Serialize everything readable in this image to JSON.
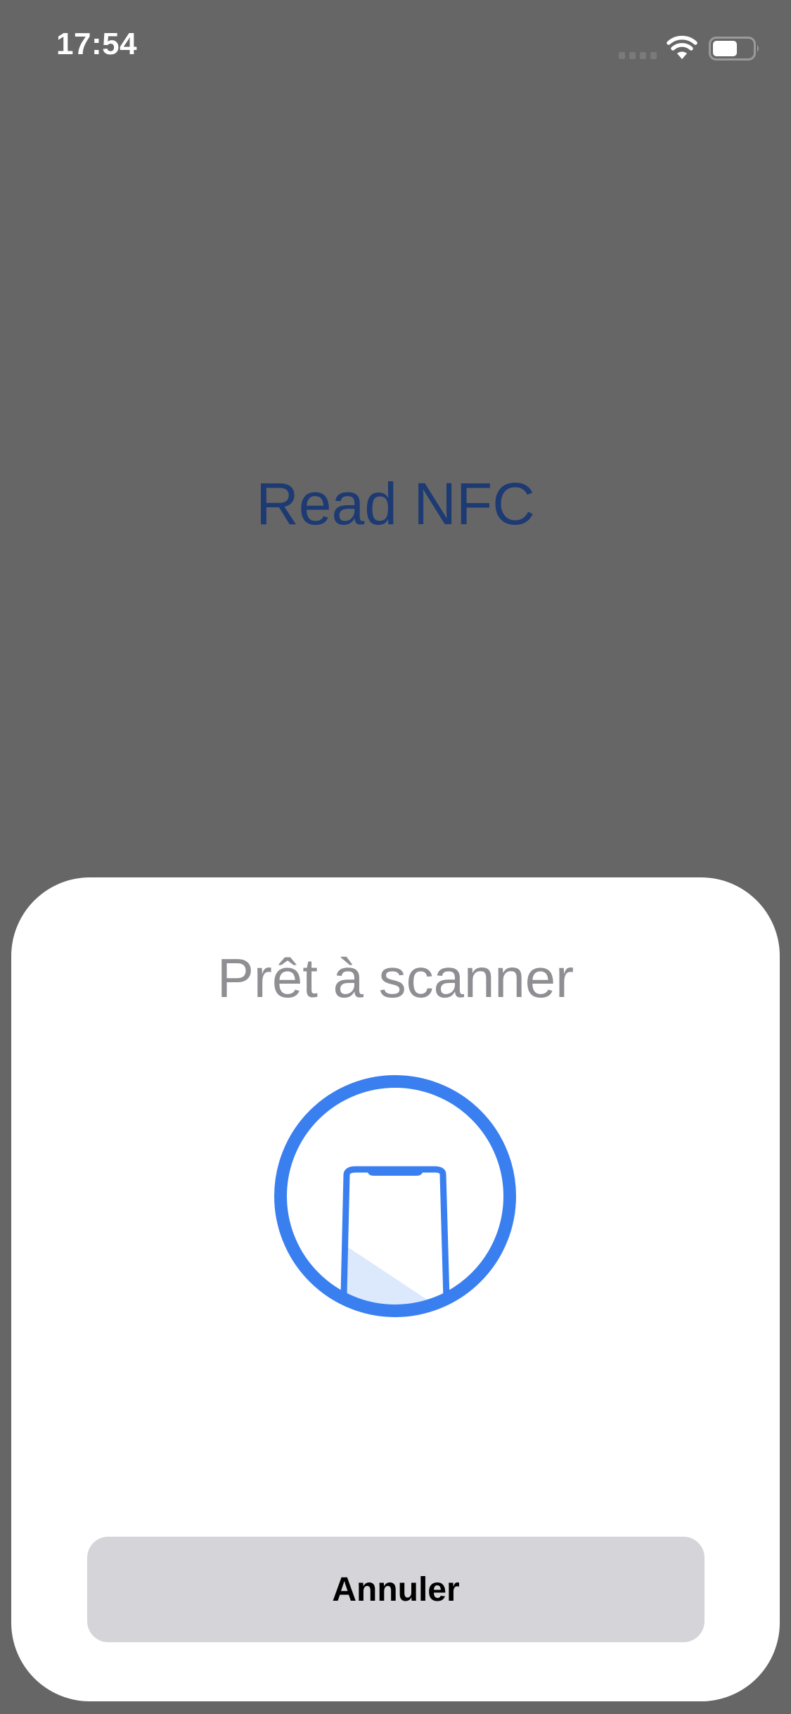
{
  "status_bar": {
    "time": "17:54",
    "icons": {
      "signal": "cellular-signal-icon",
      "wifi": "wifi-icon",
      "battery": "battery-icon"
    }
  },
  "main": {
    "title": "Read NFC"
  },
  "scan_sheet": {
    "title": "Prêt à scanner",
    "illustration": "phone-scan-icon",
    "cancel_label": "Annuler"
  },
  "colors": {
    "overlay_background": "#666666",
    "title_text": "#1d3a73",
    "accent_blue": "#3a7ff0",
    "sheet_background": "#ffffff",
    "sheet_title_text": "#8e8e93",
    "button_background": "#d4d4d9"
  }
}
